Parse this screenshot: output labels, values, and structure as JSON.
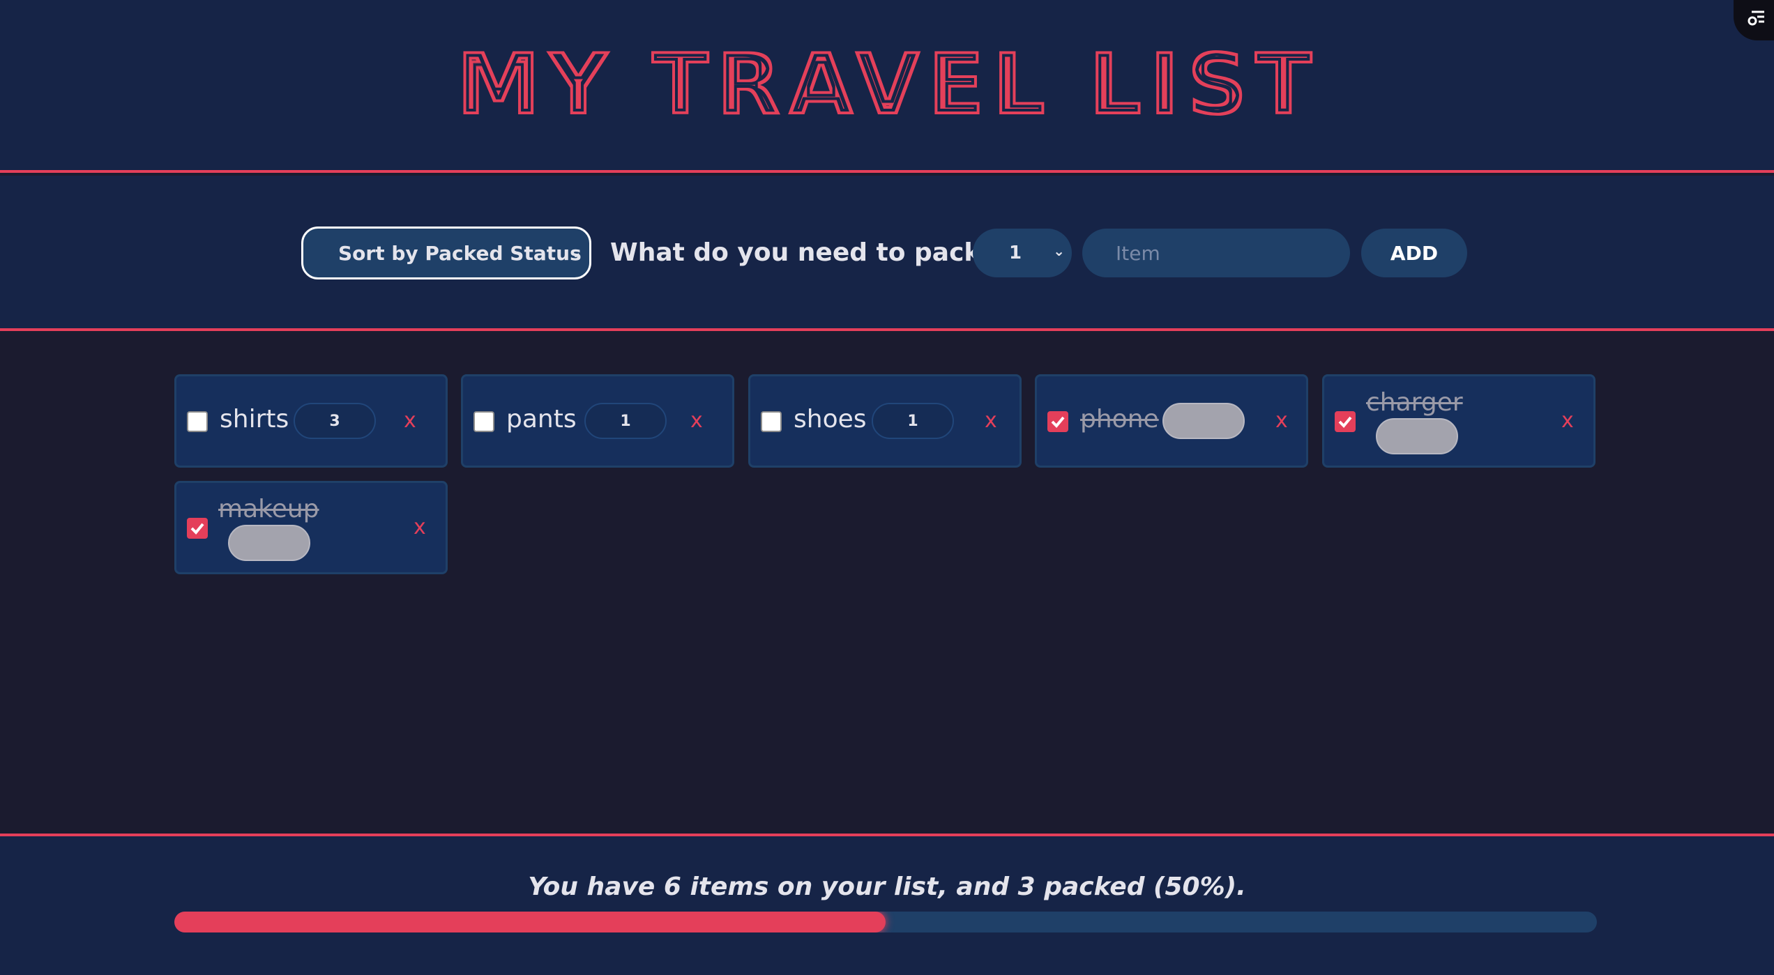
{
  "header": {
    "title": "MY TRAVEL LIST"
  },
  "form": {
    "sort_label": "Sort by Packed Status",
    "prompt": "What do you need to pack?",
    "quantity": "1",
    "item_placeholder": "Item",
    "add_label": "ADD"
  },
  "items": [
    {
      "name": "shirts",
      "quantity": "3",
      "packed": false,
      "delete": "x"
    },
    {
      "name": "pants",
      "quantity": "1",
      "packed": false,
      "delete": "x"
    },
    {
      "name": "shoes",
      "quantity": "1",
      "packed": false,
      "delete": "x"
    },
    {
      "name": "phone",
      "quantity": "",
      "packed": true,
      "delete": "x"
    },
    {
      "name": "charger",
      "quantity": "",
      "packed": true,
      "delete": "x"
    },
    {
      "name": "makeup",
      "quantity": "",
      "packed": true,
      "delete": "x"
    }
  ],
  "footer": {
    "stats": "You have 6 items on your list, and 3 packed (50%).",
    "progress_fraction": 0.5
  },
  "colors": {
    "accent": "#e43f5a",
    "header_bg": "#162447",
    "list_bg": "#1b1b2f",
    "card_bg": "#162f5c"
  },
  "icons": {
    "settings": "settings-toggle-icon",
    "chevron": "chevron-down-icon",
    "check": "check-icon"
  }
}
